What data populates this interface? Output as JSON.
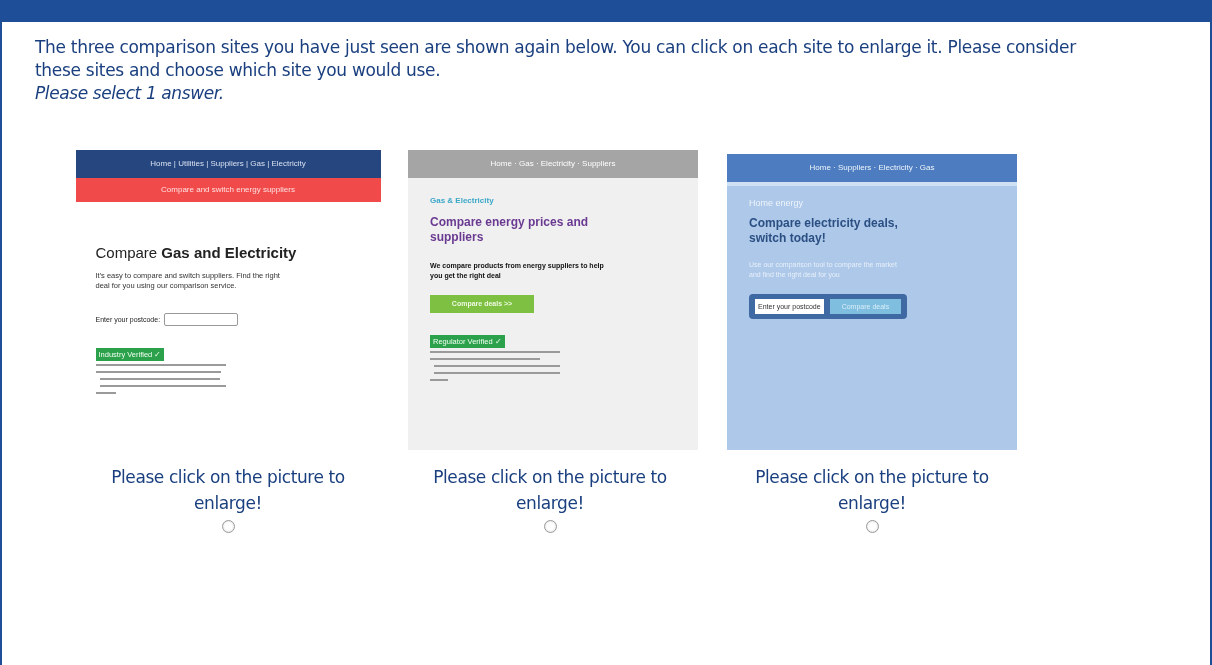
{
  "instructions": {
    "text": "The three comparison sites you have just seen are shown again below. You can click on each site to enlarge it. Please consider these sites and choose which site you would use.",
    "note": "Please select 1 answer."
  },
  "options": [
    {
      "kind": "red_banner",
      "nav": "Home | Utilities | Suppliers | Gas | Electricity",
      "banner": "Compare and switch energy suppliers",
      "heading": "Compare **Gas and Electricity**",
      "body": "It's easy to compare and switch suppliers. Find the right deal for you using our comparison service.",
      "field_label": "Enter your postcode:",
      "badge": "Industry Verified ✓",
      "caption": "Please click on the picture to enlarge!",
      "selected": false
    },
    {
      "kind": "grey_page",
      "nav": "Home · Gas · Electricity · Suppliers",
      "eyebrow": "Gas & Electricity",
      "heading": "Compare energy prices and suppliers",
      "body": "We compare products from energy suppliers to help you get the right deal",
      "button": "Compare deals >>",
      "badge": "Regulator Verified ✓",
      "caption": "Please click on the picture to enlarge!",
      "selected": false
    },
    {
      "kind": "blue_page",
      "nav": "Home · Suppliers · Electricity · Gas",
      "eyebrow": "Home energy",
      "heading": "Compare electricity deals, switch today!",
      "body": "Use our comparison tool to compare the market and find the right deal for you",
      "placeholder": "Enter your postcode",
      "button": "Compare deals",
      "caption": "Please click on the picture to enlarge!",
      "selected": false
    }
  ]
}
